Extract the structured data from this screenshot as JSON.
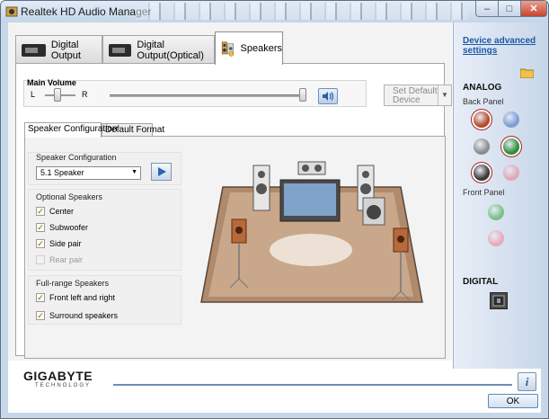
{
  "window": {
    "title": "Realtek HD Audio Manager"
  },
  "device_tabs": [
    {
      "label": "Digital Output",
      "active": false
    },
    {
      "label": "Digital Output(Optical)",
      "active": false
    },
    {
      "label": "Speakers",
      "active": true
    }
  ],
  "volume": {
    "title": "Main Volume",
    "left_label": "L",
    "right_label": "R",
    "balance_level": 0.5,
    "volume_level": 1.0,
    "set_default_label": "Set Default Device"
  },
  "sub_tabs": [
    {
      "label": "Speaker Configuration",
      "active": true
    },
    {
      "label": "Default Format",
      "active": false
    }
  ],
  "speaker_config": {
    "title": "Speaker Configuration",
    "selected": "5.1 Speaker"
  },
  "optional_speakers": {
    "title": "Optional Speakers",
    "items": [
      {
        "label": "Center",
        "checked": true,
        "enabled": true
      },
      {
        "label": "Subwoofer",
        "checked": true,
        "enabled": true
      },
      {
        "label": "Side pair",
        "checked": true,
        "enabled": true
      },
      {
        "label": "Rear pair",
        "checked": false,
        "enabled": false
      }
    ]
  },
  "fullrange_speakers": {
    "title": "Full-range Speakers",
    "items": [
      {
        "label": "Front left and right",
        "checked": true
      },
      {
        "label": "Surround speakers",
        "checked": true
      }
    ]
  },
  "right_panel": {
    "advanced_link_line1": "Device advanced",
    "advanced_link_line2": "settings",
    "analog_title": "ANALOG",
    "back_panel_label": "Back Panel",
    "front_panel_label": "Front Panel",
    "digital_title": "DIGITAL"
  },
  "jack_colors": {
    "back_orange": "#b84a2a",
    "back_blue": "#7d9fd3",
    "back_gray": "#8c8c8c",
    "back_green": "#2f8f3a",
    "back_black": "#3a3a3a",
    "back_pink": "#e2a7b9",
    "front_green": "#79c08a",
    "front_pink": "#e8a9bd"
  },
  "footer": {
    "brand": "GIGABYTE",
    "brand_tagline": "TECHNOLOGY",
    "ok_label": "OK",
    "info_label": "i"
  }
}
